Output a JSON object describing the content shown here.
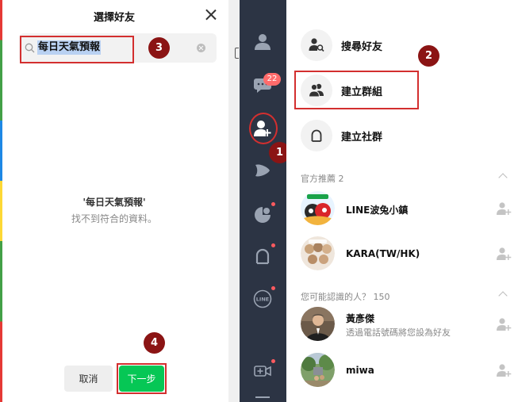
{
  "dialog": {
    "title": "選擇好友",
    "search_value": "每日天氣預報",
    "empty_title": "'每日天氣預報'",
    "empty_sub": "找不到符合的資料。",
    "cancel_label": "取消",
    "next_label": "下一步"
  },
  "annotations": {
    "step1": "1",
    "step2": "2",
    "step3": "3",
    "step4": "4",
    "color": "#d32f2f",
    "badge_color": "#8b1414"
  },
  "rail": {
    "chat_badge": "22",
    "icons": [
      "friends-icon",
      "chats-icon",
      "add-friend-icon",
      "voom-icon",
      "today-icon",
      "openchat-icon",
      "line-icon",
      "video-call-icon"
    ]
  },
  "panel": {
    "menu": [
      {
        "label": "搜尋好友",
        "icon": "search-friend-icon"
      },
      {
        "label": "建立群組",
        "icon": "group-icon"
      },
      {
        "label": "建立社群",
        "icon": "openchat-icon"
      }
    ],
    "official": {
      "header": "官方推薦 2",
      "items": [
        {
          "name": "LINE波兔小鎮"
        },
        {
          "name": "KARA(TW/HK)"
        }
      ]
    },
    "suggest": {
      "header": "您可能認識的人？ 150",
      "items": [
        {
          "name": "黃彥傑",
          "sub": "透過電話號碼將您設為好友"
        },
        {
          "name": "miwa",
          "sub": ""
        }
      ]
    }
  },
  "colors": {
    "accent_green": "#06c755",
    "rail_bg": "#2c3444",
    "highlight": "#b9d1f2"
  }
}
